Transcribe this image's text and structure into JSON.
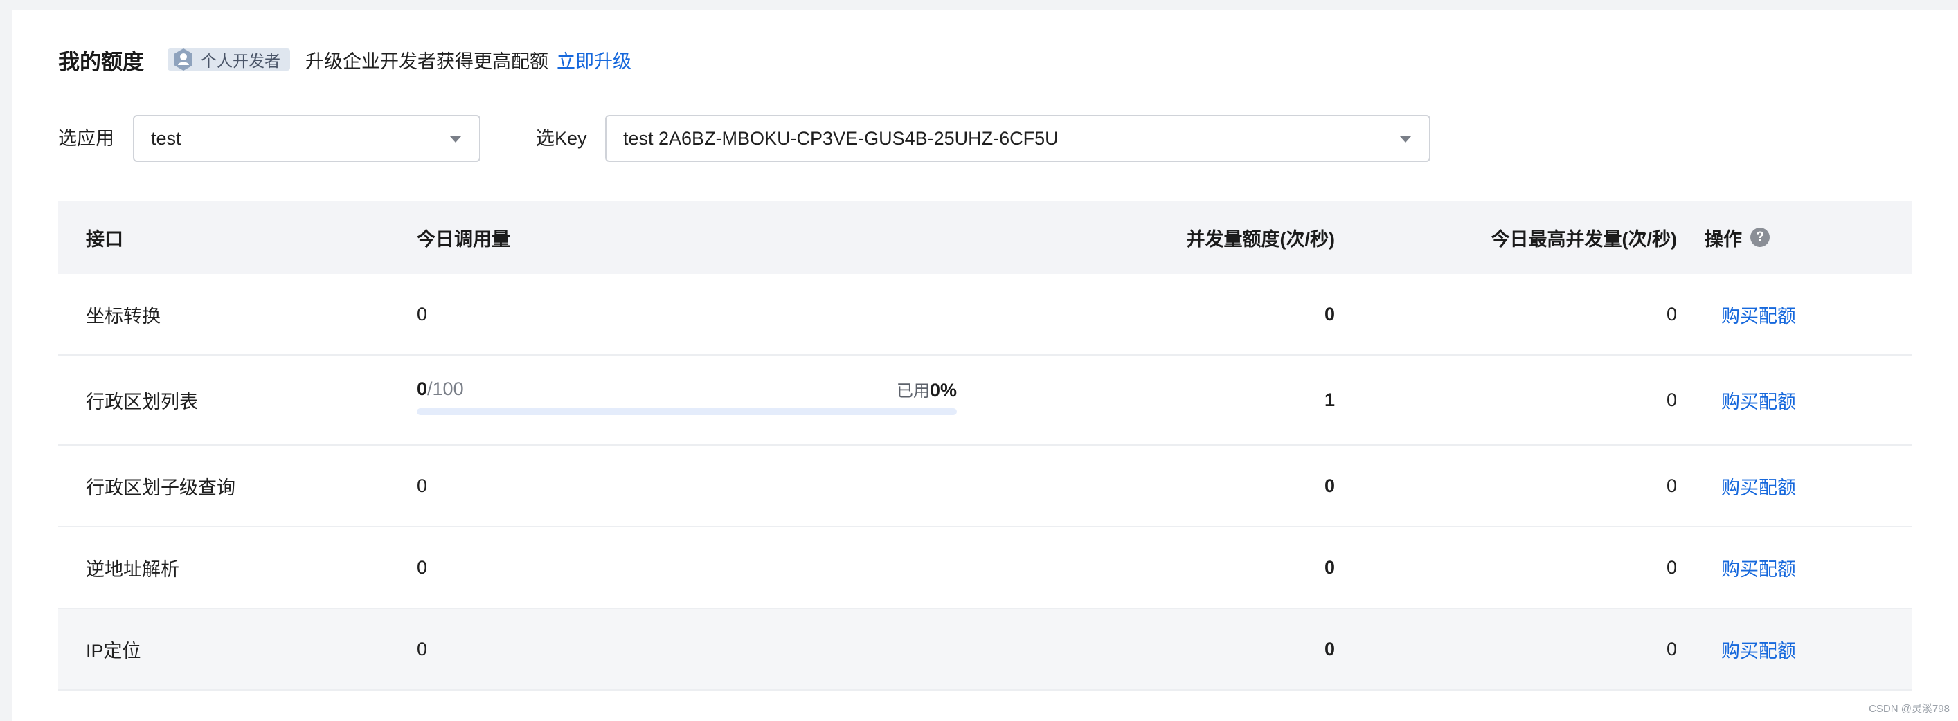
{
  "header": {
    "title": "我的额度",
    "badge_label": "个人开发者",
    "badge_icon": "person-icon",
    "upgrade_text": "升级企业开发者获得更高配额",
    "upgrade_link": "立即升级"
  },
  "filters": {
    "app_label": "选应用",
    "app_value": "test",
    "key_label": "选Key",
    "key_value": "test 2A6BZ-MBOKU-CP3VE-GUS4B-25UHZ-6CF5U"
  },
  "table": {
    "columns": {
      "name": "接口",
      "today_calls": "今日调用量",
      "concurrency": "并发量额度(次/秒)",
      "max_concurrency": "今日最高并发量(次/秒)",
      "action": "操作"
    },
    "rows": [
      {
        "name": "坐标转换",
        "today_calls": "0",
        "concurrency": "0",
        "max_concurrency": "0",
        "action": "购买配额"
      },
      {
        "name": "行政区划列表",
        "usage_used": "0",
        "usage_total": "/100",
        "usage_pct_label": "已用",
        "usage_pct": "0%",
        "usage_fraction": 0,
        "concurrency": "1",
        "max_concurrency": "0",
        "action": "购买配额"
      },
      {
        "name": "行政区划子级查询",
        "today_calls": "0",
        "concurrency": "0",
        "max_concurrency": "0",
        "action": "购买配额"
      },
      {
        "name": "逆地址解析",
        "today_calls": "0",
        "concurrency": "0",
        "max_concurrency": "0",
        "action": "购买配额"
      },
      {
        "name": "IP定位",
        "today_calls": "0",
        "concurrency": "0",
        "max_concurrency": "0",
        "action": "购买配额"
      }
    ]
  },
  "watermark": "CSDN @灵溪798",
  "colors": {
    "link": "#1668dc",
    "header_bg": "#f3f4f7",
    "badge_bg": "#dfe6ef"
  }
}
